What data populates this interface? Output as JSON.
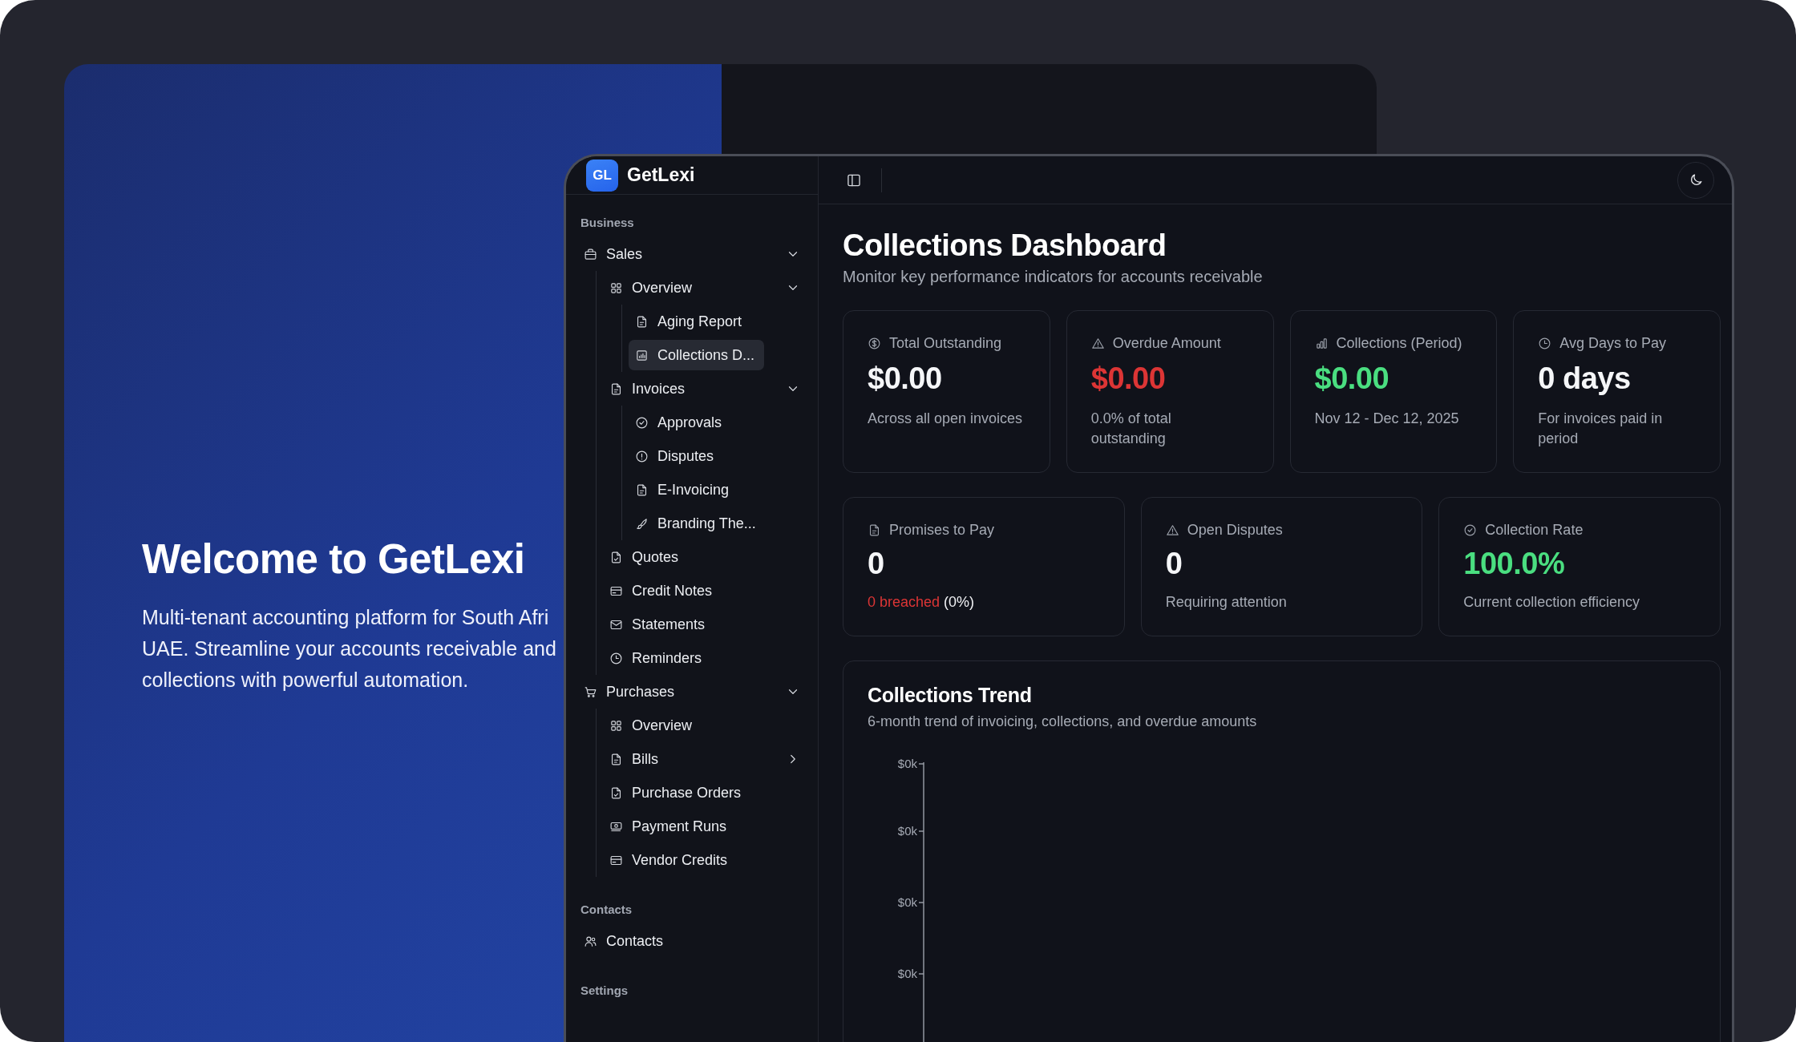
{
  "hero": {
    "title": "Welcome to GetLexi",
    "lines": [
      "Multi-tenant accounting platform for South Afri",
      "UAE. Streamline your accounts receivable and",
      "collections with powerful automation."
    ]
  },
  "brand": {
    "badge": "GL",
    "name": "GetLexi"
  },
  "sidebar": {
    "sections": [
      {
        "label": "Business",
        "items": [
          {
            "label": "Sales",
            "expanded": true,
            "selected": false,
            "children": [
              {
                "label": "Overview",
                "expanded": true,
                "selected": false,
                "children": [
                  {
                    "label": "Aging Report",
                    "selected": false
                  },
                  {
                    "label": "Collections D...",
                    "selected": true
                  }
                ]
              },
              {
                "label": "Invoices",
                "expanded": true,
                "selected": false,
                "children": [
                  {
                    "label": "Approvals",
                    "selected": false
                  },
                  {
                    "label": "Disputes",
                    "selected": false
                  },
                  {
                    "label": "E-Invoicing",
                    "selected": false
                  },
                  {
                    "label": "Branding The...",
                    "selected": false
                  }
                ]
              },
              {
                "label": "Quotes",
                "selected": false
              },
              {
                "label": "Credit Notes",
                "selected": false
              },
              {
                "label": "Statements",
                "selected": false
              },
              {
                "label": "Reminders",
                "selected": false
              }
            ]
          },
          {
            "label": "Purchases",
            "expanded": true,
            "selected": false,
            "children": [
              {
                "label": "Overview",
                "selected": false
              },
              {
                "label": "Bills",
                "expanded": false,
                "selected": false
              },
              {
                "label": "Purchase Orders",
                "selected": false
              },
              {
                "label": "Payment Runs",
                "selected": false
              },
              {
                "label": "Vendor Credits",
                "selected": false
              }
            ]
          }
        ]
      },
      {
        "label": "Contacts",
        "items": [
          {
            "label": "Contacts",
            "selected": false
          }
        ]
      },
      {
        "label": "Settings"
      }
    ]
  },
  "page": {
    "title": "Collections Dashboard",
    "subtitle": "Monitor key performance indicators for accounts receivable"
  },
  "stats": [
    {
      "label": "Total Outstanding",
      "value": "$0.00",
      "color": "#f5f6f8",
      "note": "Across all open invoices"
    },
    {
      "label": "Overdue Amount",
      "value": "$0.00",
      "color": "#dc3535",
      "note": "0.0% of total outstanding"
    },
    {
      "label": "Collections (Period)",
      "value": "$0.00",
      "color": "#4ade80",
      "note": "Nov 12 - Dec 12, 2025"
    },
    {
      "label": "Avg Days to Pay",
      "value": "0 days",
      "color": "#f5f6f8",
      "note": "For invoices paid in period"
    }
  ],
  "stats_secondary": [
    {
      "label": "Promises to Pay",
      "value": "0",
      "color": "#f5f6f8",
      "note_alert": "0 breached",
      "note": "(0%)"
    },
    {
      "label": "Open Disputes",
      "value": "0",
      "color": "#f5f6f8",
      "note": "Requiring attention"
    },
    {
      "label": "Collection Rate",
      "value": "100.0%",
      "color": "#4ade80",
      "note": "Current collection efficiency"
    }
  ],
  "chart": {
    "title": "Collections Trend",
    "subtitle": "6-month trend of invoicing, collections, and overdue amounts",
    "y_tick_labels": [
      "$0k",
      "$0k",
      "$0k",
      "$0k"
    ]
  }
}
